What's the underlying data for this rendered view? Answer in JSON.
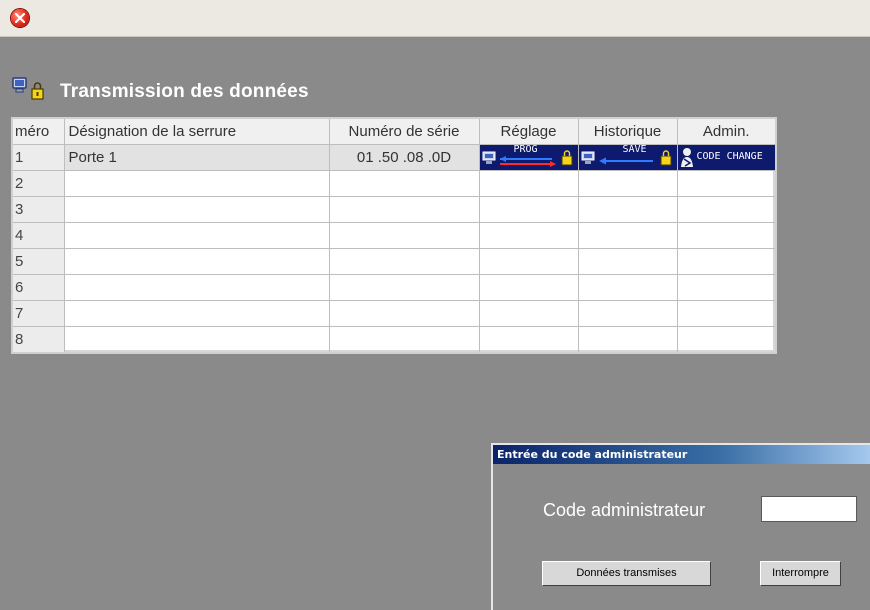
{
  "title": "Transmission des données",
  "table": {
    "headers": [
      "méro",
      "Désignation de la serrure",
      "Numéro de série",
      "Réglage",
      "Historique",
      "Admin."
    ],
    "rows": [
      {
        "num": "1",
        "designation": "Porte 1",
        "serial": "01 .50 .08 .0D"
      },
      {
        "num": "2",
        "designation": "",
        "serial": ""
      },
      {
        "num": "3",
        "designation": "",
        "serial": ""
      },
      {
        "num": "4",
        "designation": "",
        "serial": ""
      },
      {
        "num": "5",
        "designation": "",
        "serial": ""
      },
      {
        "num": "6",
        "designation": "",
        "serial": ""
      },
      {
        "num": "7",
        "designation": "",
        "serial": ""
      },
      {
        "num": "8",
        "designation": "",
        "serial": ""
      }
    ],
    "actions": {
      "reglage": "PROG",
      "historique": "SAVE",
      "admin": "CODE CHANGE"
    }
  },
  "dialog": {
    "title": "Entrée du code administrateur",
    "label": "Code administrateur",
    "input_value": "",
    "send_button": "Données transmises",
    "stop_button": "Interrompre"
  },
  "colors": {
    "background": "#8a8a8a",
    "action_cell": "#0d1a6e",
    "dialog_title_start": "#0a246a",
    "close": "#e8281a"
  },
  "icons": {
    "close": "close-icon",
    "title": "computer-lock-icon",
    "reglage": "prog-transfer-icon",
    "historique": "save-transfer-icon",
    "admin": "code-change-icon"
  }
}
